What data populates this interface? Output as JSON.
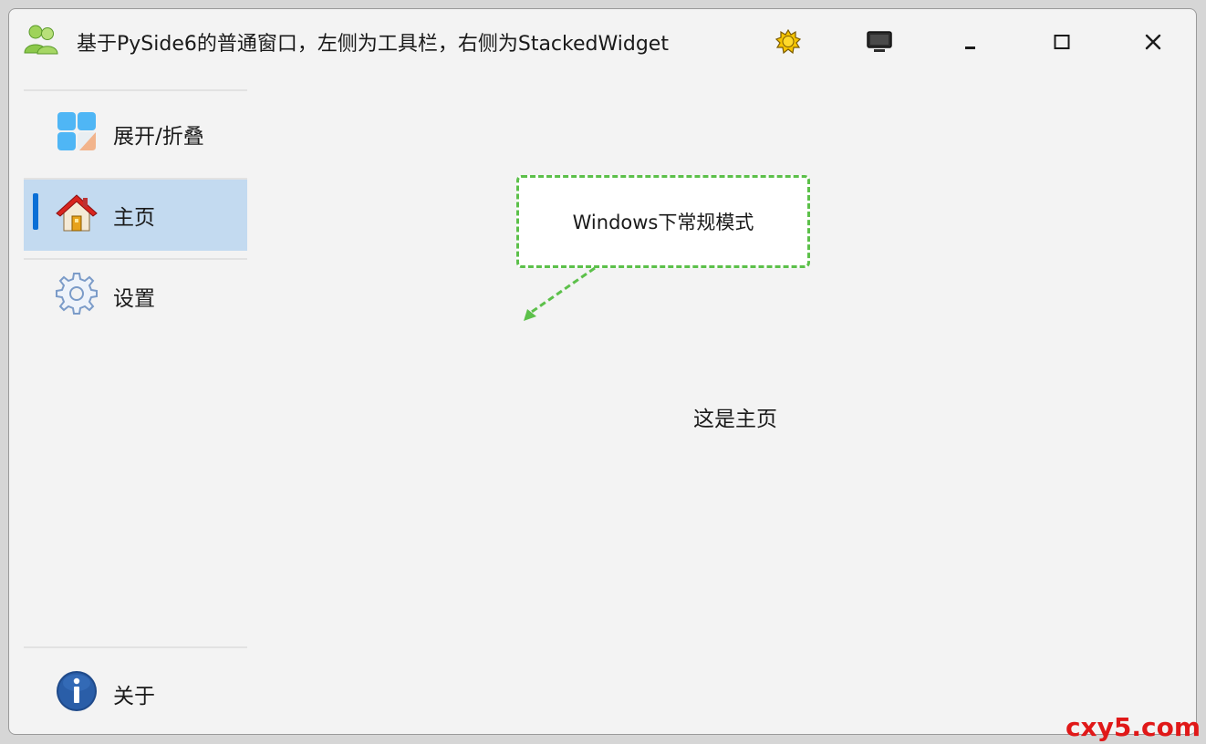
{
  "window": {
    "title": "基于PySide6的普通窗口，左侧为工具栏，右侧为StackedWidget",
    "controls": [
      "theme-toggle",
      "display-mode",
      "minimize",
      "maximize",
      "close"
    ]
  },
  "sidebar": {
    "items": [
      {
        "label": "展开/折叠",
        "icon": "tiles-icon",
        "active": false
      },
      {
        "label": "主页",
        "icon": "home-icon",
        "active": true
      },
      {
        "label": "设置",
        "icon": "gear-icon",
        "active": false
      }
    ],
    "bottom_items": [
      {
        "label": "关于",
        "icon": "info-icon",
        "active": false
      }
    ]
  },
  "content": {
    "tooltip_text": "Windows下常规模式",
    "page_text": "这是主页"
  },
  "colors": {
    "accent": "#0a6fd6",
    "active_bg": "#c3daf0",
    "tooltip_border": "#5cc04a",
    "watermark": "#e01818"
  },
  "watermark": "cxy5.com"
}
